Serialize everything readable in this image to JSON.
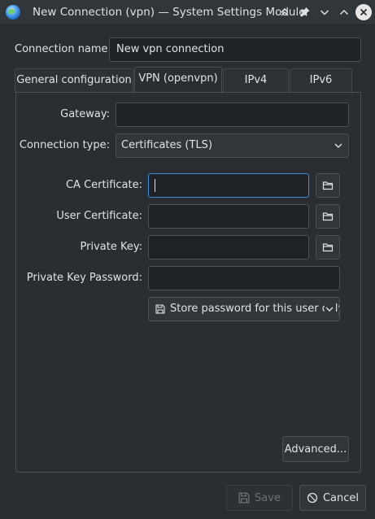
{
  "window": {
    "title": "New Connection (vpn) — System Settings Module"
  },
  "connection_name": {
    "label": "Connection name:",
    "value": "New vpn connection"
  },
  "tabs": [
    {
      "label": "General configuration"
    },
    {
      "label": "VPN (openvpn)",
      "active": true
    },
    {
      "label": "IPv4"
    },
    {
      "label": "IPv6"
    }
  ],
  "vpn": {
    "gateway": {
      "label": "Gateway:",
      "value": ""
    },
    "connection_type": {
      "label": "Connection type:",
      "value": "Certificates (TLS)"
    },
    "ca_certificate": {
      "label": "CA Certificate:",
      "value": ""
    },
    "user_certificate": {
      "label": "User Certificate:",
      "value": ""
    },
    "private_key": {
      "label": "Private Key:",
      "value": ""
    },
    "private_key_password": {
      "label": "Private Key Password:",
      "value": ""
    },
    "password_storage": {
      "value": "Store password for this user only"
    },
    "advanced_label": "Advanced..."
  },
  "footer": {
    "save_label": "Save",
    "cancel_label": "Cancel"
  },
  "colors": {
    "background": "#2a2e32",
    "focus_accent": "#3d8fd6"
  }
}
